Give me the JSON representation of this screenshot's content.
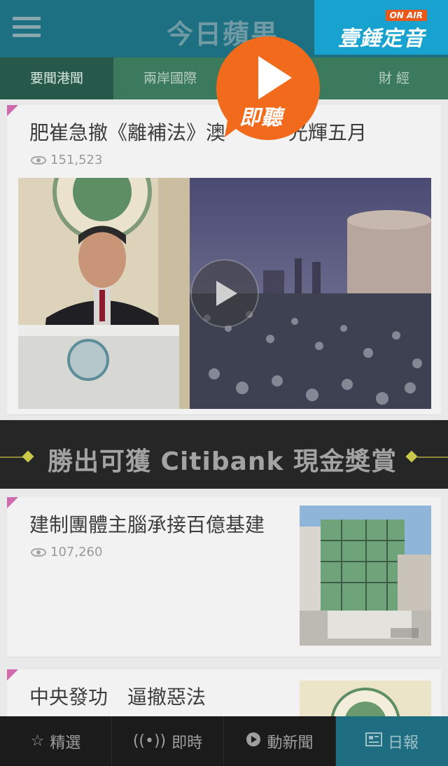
{
  "header": {
    "title": "今日蘋果",
    "onair_badge": "ON AIR",
    "onair_name": "壹錘定音",
    "listen_label": "即聽"
  },
  "tabs": [
    {
      "label": "要聞港聞",
      "active": true
    },
    {
      "label": "兩岸國際",
      "active": false
    },
    {
      "label": "",
      "active": false
    },
    {
      "label": "財 經",
      "active": false
    }
  ],
  "articles": [
    {
      "headline": "肥崔急撤《離補法》澳",
      "headline_tail": "光輝五月",
      "views": "151,523"
    },
    {
      "headline": "建制團體主腦承接百億基建",
      "views": "107,260"
    },
    {
      "headline": "中央發功　逼撤惡法"
    }
  ],
  "banner": {
    "text": "勝出可獲 Citibank 現金獎賞"
  },
  "bottom_nav": [
    {
      "label": "精選",
      "icon": "star-icon"
    },
    {
      "label": "即時",
      "icon": "broadcast-icon"
    },
    {
      "label": "動新聞",
      "icon": "play-circle-icon"
    },
    {
      "label": "日報",
      "icon": "newspaper-icon",
      "active": true
    }
  ],
  "colors": {
    "header": "#1d6f82",
    "tab_bar": "#3c7a5e",
    "onair": "#17a2cf",
    "listen_bubble": "#f26a1b",
    "bottom_nav_active": "#1f6d80"
  }
}
